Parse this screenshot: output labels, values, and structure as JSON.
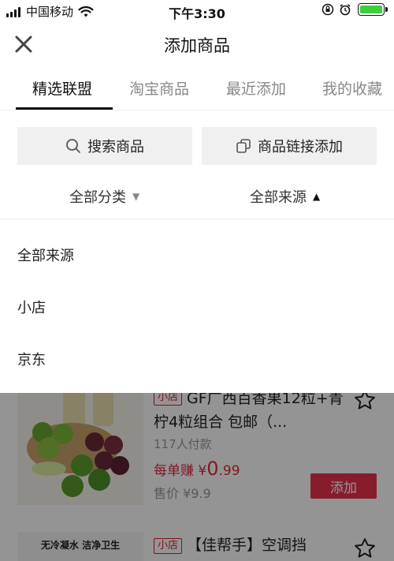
{
  "status_bar": {
    "carrier": "中国移动",
    "time": "下午3:30",
    "battery_level": 1.0,
    "battery_color": "#3ecf3e"
  },
  "header": {
    "title": "添加商品",
    "close_icon": "close-icon"
  },
  "tabs": [
    {
      "label": "精选联盟",
      "active": true
    },
    {
      "label": "淘宝商品",
      "active": false
    },
    {
      "label": "最近添加",
      "active": false
    },
    {
      "label": "我的收藏",
      "active": false
    }
  ],
  "actions": {
    "search_label": "搜索商品",
    "link_add_label": "商品链接添加"
  },
  "filters": {
    "category_label": "全部分类",
    "source_label": "全部来源"
  },
  "dropdown": {
    "items": [
      "全部来源",
      "小店",
      "京东"
    ]
  },
  "products": [
    {
      "badge": "小店",
      "title": "GF广西百香果12粒+青柠4粒组合 包邮（...",
      "sold": "117人付款",
      "earn_prefix": "每单赚 ¥",
      "earn_big": "0",
      "earn_small": ".99",
      "price": "售价 ¥9.9",
      "add_label": "添加"
    },
    {
      "badge": "小店",
      "title": "【佳帮手】空调挡",
      "thumb_text": "无冷凝水 洁净卫生"
    }
  ],
  "colors": {
    "accent": "#e8324a",
    "earn": "#e02a3a",
    "badge": "#dd2233"
  }
}
